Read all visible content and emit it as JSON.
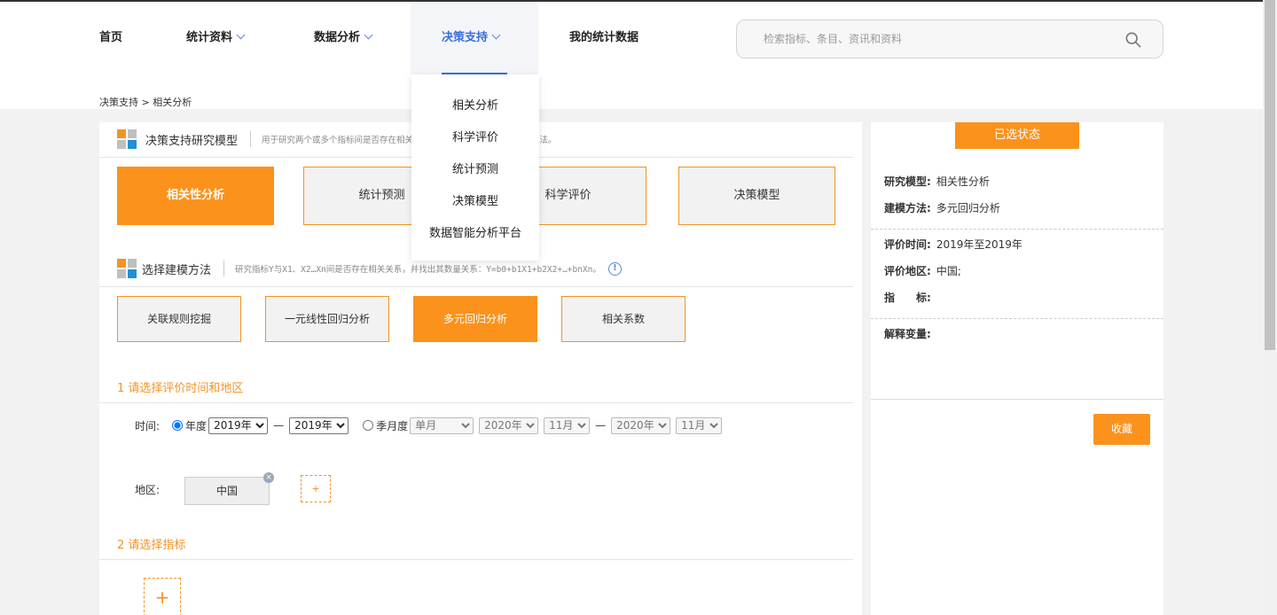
{
  "nav": {
    "items": [
      {
        "label": "首页",
        "has_chevron": false
      },
      {
        "label": "统计资料",
        "has_chevron": true
      },
      {
        "label": "数据分析",
        "has_chevron": true
      },
      {
        "label": "决策支持",
        "has_chevron": true,
        "active": true
      },
      {
        "label": "我的统计数据",
        "has_chevron": false
      }
    ],
    "search_placeholder": "检索指标、条目、资讯和资料"
  },
  "dropdown": {
    "items": [
      "相关分析",
      "科学评价",
      "统计预测",
      "决策模型",
      "数据智能分析平台"
    ]
  },
  "breadcrumb": "决策支持 > 相关分析",
  "model_section": {
    "title": "决策支持研究模型",
    "desc": "用于研究两个或多个指标间是否存在相关关系，并找出其数量关系的建模方法。",
    "buttons": [
      "相关性分析",
      "统计预测",
      "科学评价",
      "决策模型"
    ],
    "active_index": 0
  },
  "method_section": {
    "title": "选择建模方法",
    "desc": "研究指标Y与X1、X2…Xn间是否存在相关关系，并找出其数量关系：Y=b0+b1X1+b2X2+…+bnXn。",
    "info_icon": "!",
    "buttons": [
      "关联规则挖掘",
      "一元线性回归分析",
      "多元回归分析",
      "相关系数"
    ],
    "active_index": 2
  },
  "step1": {
    "title": "1  请选择评价时间和地区",
    "time_label": "时间:",
    "year_radio_label": "年度",
    "year_from": "2019年",
    "year_to": "2019年",
    "dash": "—",
    "month_radio_label": "季月度",
    "period_select": "单月",
    "m_year_from": "2020年",
    "m_month_from": "11月",
    "m_year_to": "2020年",
    "m_month_to": "11月",
    "region_label": "地区:",
    "region_tag": "中国",
    "add_symbol": "+"
  },
  "step2": {
    "title": "2  请选择指标",
    "add_symbol": "+"
  },
  "side": {
    "header": "已选状态",
    "research_model_label": "研究模型:",
    "research_model": "相关性分析",
    "modeling_method_label": "建模方法:",
    "modeling_method": "多元回归分析",
    "eval_time_label": "评价时间:",
    "eval_time": "2019年至2019年",
    "eval_region_label": "评价地区:",
    "eval_region": "中国;",
    "indicator_label": "指　　标:",
    "explanatory_label": "解释变量:",
    "collect_button": "收藏"
  },
  "colors": {
    "accent": "#fb921c",
    "nav_active": "#3b6fd8",
    "logo_orange": "#f39325",
    "logo_blue": "#1f8fd6",
    "logo_gray": "#bfbfbf"
  }
}
